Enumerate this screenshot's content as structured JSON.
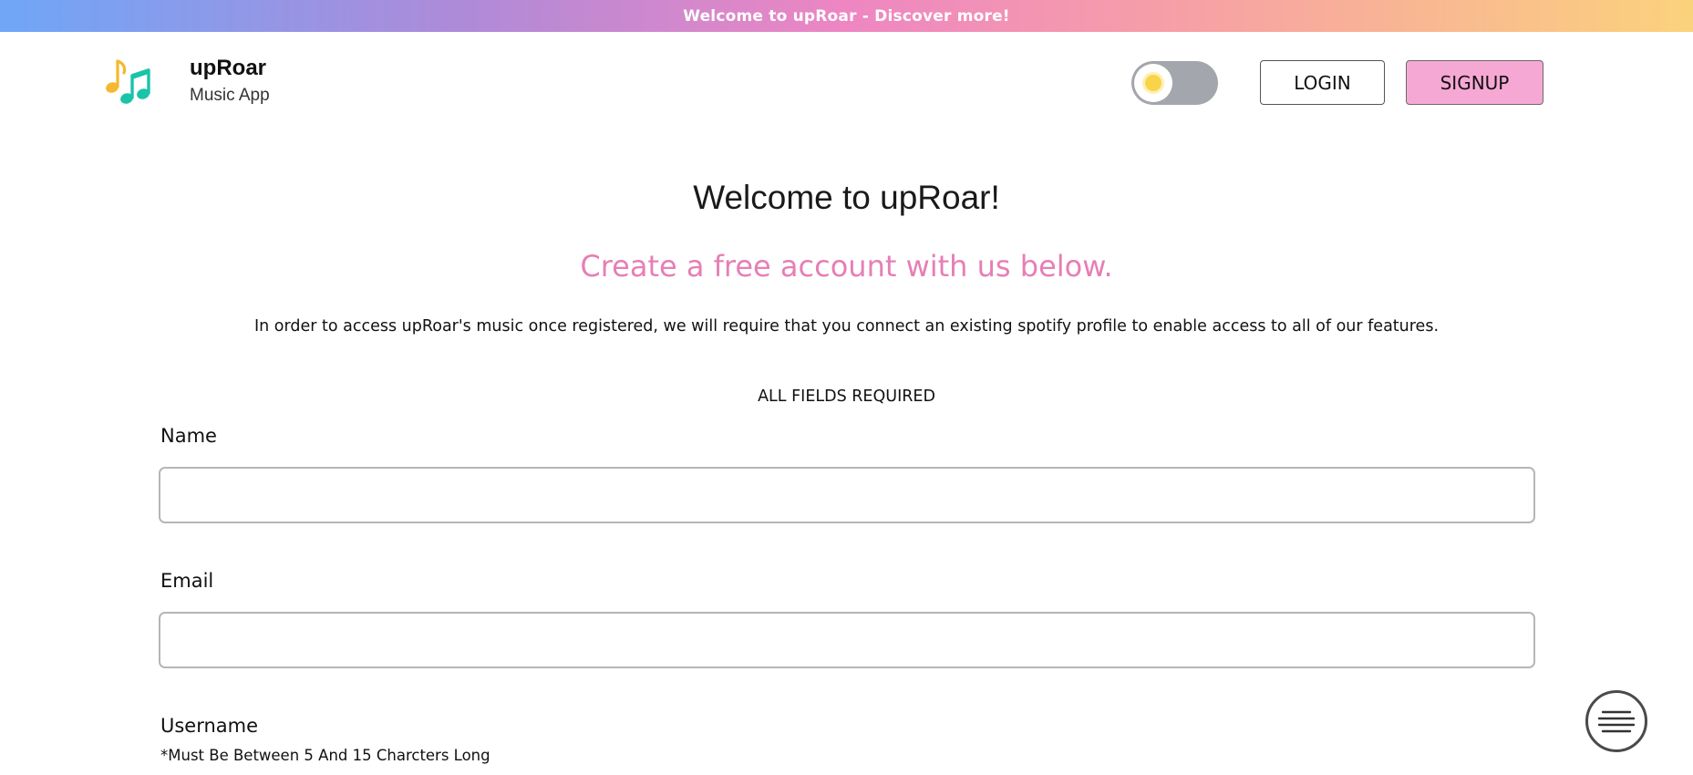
{
  "banner": {
    "text": "Welcome to upRoar - Discover more!"
  },
  "header": {
    "logo_icon": "music-notes-icon",
    "brand_name": "upRoar",
    "brand_subtitle": "Music App",
    "theme_toggle_icon": "sun-icon",
    "login_label": "LOGIN",
    "signup_label": "SIGNUP"
  },
  "main": {
    "welcome_heading": "Welcome to upRoar!",
    "subheading": "Create a free account with us below.",
    "description": "In order to access upRoar's music once registered, we will require that you connect an existing spotify profile to enable access to all of our features.",
    "required_note": "ALL FIELDS REQUIRED",
    "fields": {
      "name": {
        "label": "Name",
        "value": ""
      },
      "email": {
        "label": "Email",
        "value": ""
      },
      "username": {
        "label": "Username",
        "hint": "*Must Be Between 5 And 15 Charcters Long"
      }
    }
  },
  "menu_button": {
    "icon": "menu-icon"
  },
  "colors": {
    "signup_background": "#f6a8d4",
    "subheading": "#e67fb5",
    "toggle_track": "#a3a6ad",
    "sun": "#f9d44a",
    "banner_gradient": [
      "#6fa6f7",
      "#b08ad8",
      "#ee86c2",
      "#f7a3a3",
      "#fbd27c"
    ]
  }
}
